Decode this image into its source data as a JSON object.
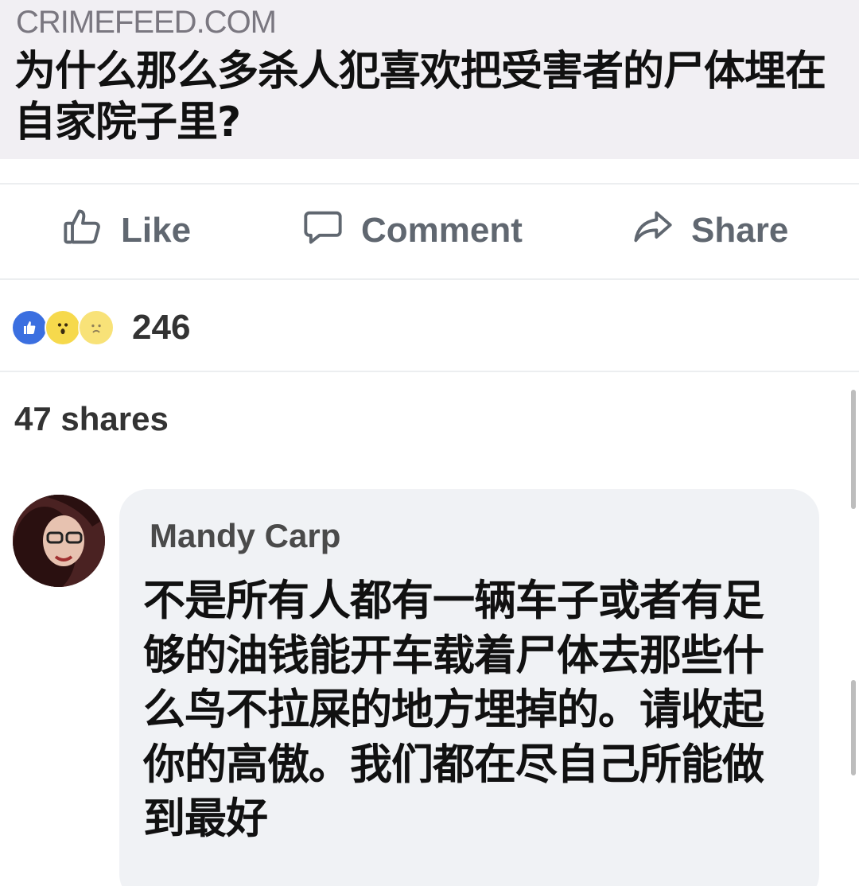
{
  "link_preview": {
    "domain": "CRIMEFEED.COM",
    "headline": "为什么那么多杀人犯喜欢把受害者的尸体埋在自家院子里?"
  },
  "actions": {
    "like_label": "Like",
    "comment_label": "Comment",
    "share_label": "Share"
  },
  "reactions": {
    "icons": [
      "like-icon",
      "wow-icon",
      "sad-icon"
    ],
    "count": "246"
  },
  "shares_text": "47 shares",
  "comment": {
    "author": "Mandy Carp",
    "text": "不是所有人都有一辆车子或者有足够的油钱能开车载着尸体去那些什么鸟不拉屎的地方埋掉的。请收起你的高傲。我们都在尽自己所能做到最好"
  },
  "colors": {
    "header_bg": "#f1eff3",
    "action_text": "#606770",
    "like_blue": "#3b6fe0",
    "reaction_yellow": "#f6d94c",
    "comment_bg": "#f0f2f5"
  }
}
